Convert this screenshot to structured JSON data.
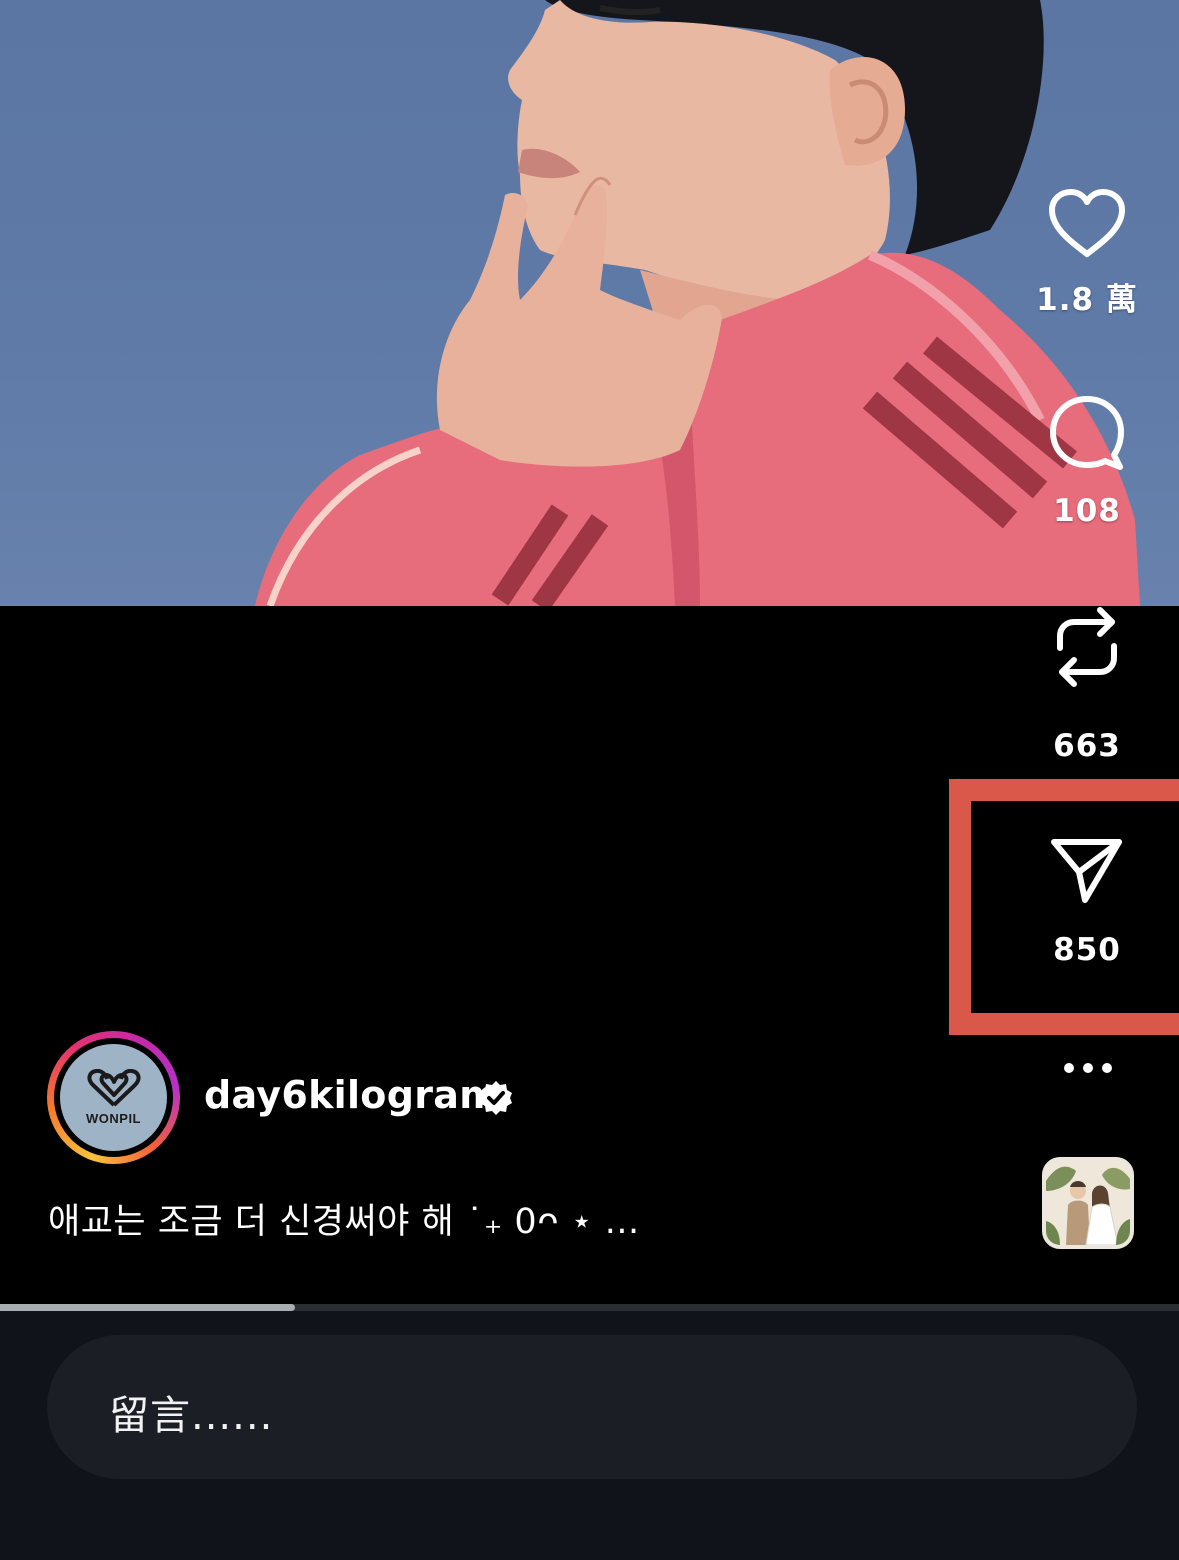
{
  "post": {
    "author": "day6kilogram",
    "avatar_label": "WONPIL",
    "caption": "애교는 조금 더 신경써야 해 ˙₊ 0ᴖ ⋆ ...",
    "verified": true
  },
  "actions": {
    "likes": "1.8 萬",
    "comments": "108",
    "reposts": "663",
    "shares": "850"
  },
  "video": {
    "progress": 0.25
  },
  "comment_input": {
    "placeholder": "留言......"
  },
  "colors": {
    "highlight": "#d9584a",
    "background": "#000000",
    "bottom_bar": "#10141a",
    "jacket": "#e76c7c",
    "backdrop": "#5f7aa7"
  },
  "icons": [
    "heart-icon",
    "comment-icon",
    "repost-icon",
    "share-icon",
    "more-icon",
    "verified-icon",
    "music-thumbnail"
  ]
}
